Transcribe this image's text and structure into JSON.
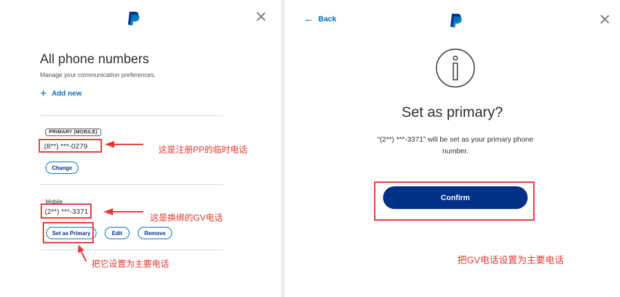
{
  "left_panel": {
    "title": "All phone numbers",
    "subtitle": "Manage your communication preferences.",
    "add_new_icon": "+",
    "add_new_label": "Add new",
    "primary": {
      "badge": "PRIMARY (MOBILE)",
      "number": "(8**) ***-0279",
      "change_label": "Change"
    },
    "secondary": {
      "label": "Mobile",
      "number": "(2**) ***-3371",
      "set_primary_label": "Set as Primary",
      "edit_label": "Edit",
      "remove_label": "Remove"
    },
    "annotations": {
      "note_primary": "这是注册PP的临时电话",
      "note_secondary": "这是换绑的GV电话",
      "note_set_primary": "把它设置为主要电话"
    }
  },
  "right_panel": {
    "back_icon": "←",
    "back_label": "Back",
    "dialog_title": "Set as primary?",
    "dialog_body": "“(2**) ***-3371” will be set as your primary phone number.",
    "confirm_label": "Confirm",
    "annotation": "把GV电话设置为主要电话"
  },
  "colors": {
    "brand_dark": "#003087",
    "brand_blue": "#0070ba",
    "annotation_red": "#e53935"
  }
}
